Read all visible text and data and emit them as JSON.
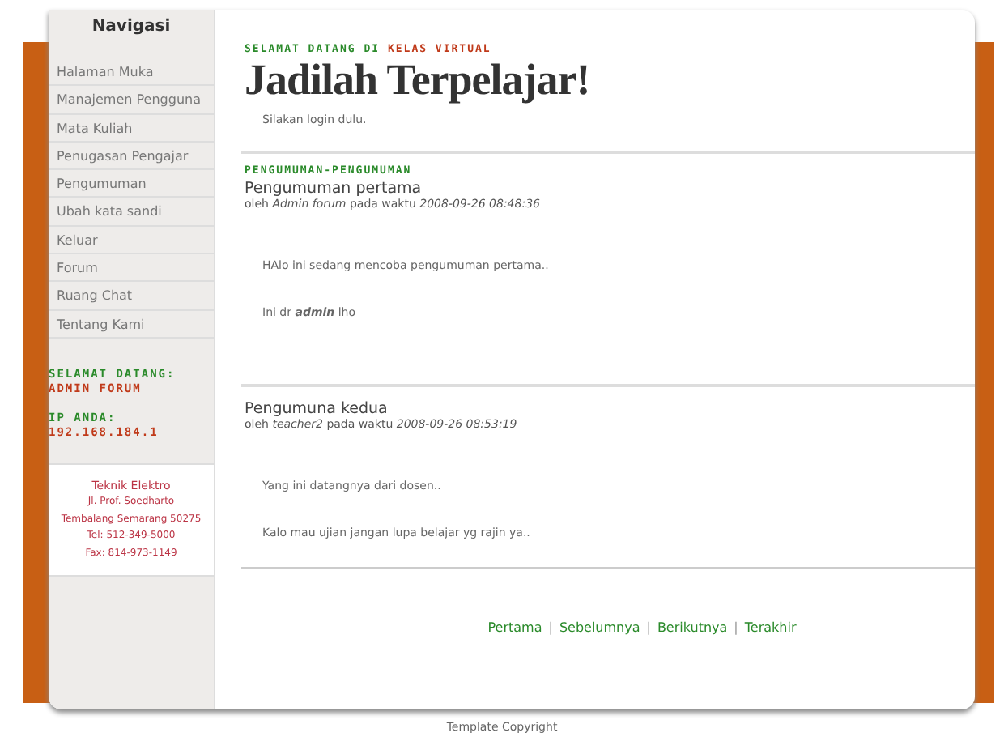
{
  "sidebar": {
    "title": "Navigasi",
    "items": [
      {
        "label": "Halaman Muka"
      },
      {
        "label": "Manajemen Pengguna"
      },
      {
        "label": "Mata Kuliah"
      },
      {
        "label": "Penugasan Pengajar"
      },
      {
        "label": "Pengumuman"
      },
      {
        "label": "Ubah kata sandi"
      },
      {
        "label": "Keluar"
      },
      {
        "label": "Forum"
      },
      {
        "label": "Ruang Chat"
      },
      {
        "label": "Tentang Kami"
      }
    ],
    "welcome_label": "SELAMAT DATANG:",
    "welcome_user": "ADMIN FORUM",
    "ip_label": "IP ANDA:",
    "ip_value": "192.168.184.1",
    "address": [
      "Teknik Elektro",
      "Jl. Prof. Soedharto",
      "Tembalang Semarang 50275",
      "Tel: 512-349-5000",
      "Fax: 814-973-1149"
    ]
  },
  "header": {
    "kicker": "SELAMAT DATANG DI",
    "kicker_highlight": "KELAS VIRTUAL",
    "title": "Jadilah Terpelajar!",
    "note": "Silakan login dulu."
  },
  "section_title": "PENGUMUMAN-PENGUMUMAN",
  "posts": [
    {
      "title": "Pengumuman pertama",
      "meta": "oleh *Admin forum* pada waktu *2008-09-26 08:48:36*",
      "paragraphs": [
        "HAlo ini sedang mencoba pengumuman pertama..",
        "Ini dr **admin** lho"
      ]
    },
    {
      "title": "Pengumuna kedua",
      "meta": "oleh *teacher2* pada waktu *2008-09-26 08:53:19*",
      "paragraphs": [
        "Yang ini datangnya dari dosen..",
        "Kalo mau ujian jangan lupa belajar yg rajin ya.."
      ]
    }
  ],
  "pagination": [
    "Pertama",
    "Sebelumnya",
    "Berikutnya",
    "Terakhir"
  ],
  "pagination_separator": "|",
  "footer": "Template Copyright"
}
